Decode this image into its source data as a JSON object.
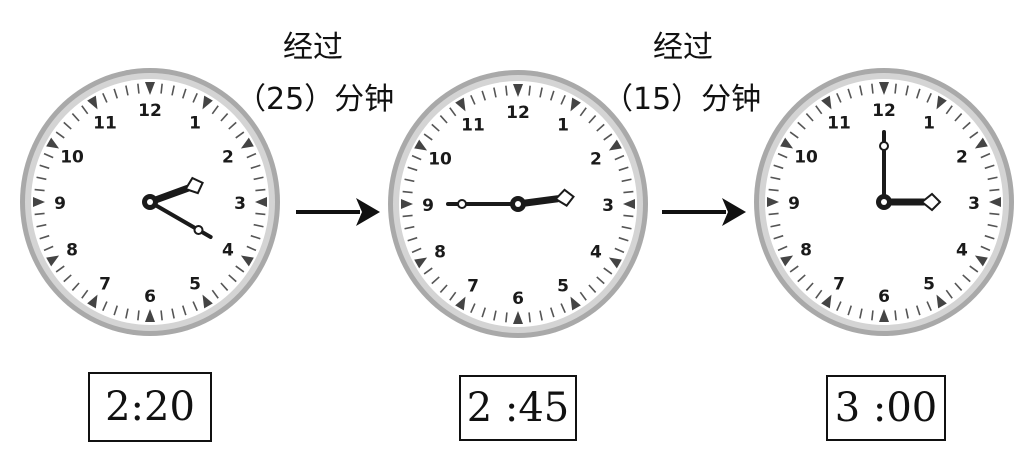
{
  "clocks": [
    {
      "id": "clock-1",
      "hour": 2,
      "minute": 20,
      "time_label": "2:20"
    },
    {
      "id": "clock-2",
      "hour": 2,
      "minute": 45,
      "time_label": "2 :45"
    },
    {
      "id": "clock-3",
      "hour": 3,
      "minute": 0,
      "time_label": "3 :00"
    }
  ],
  "dial_numbers": [
    "12",
    "1",
    "2",
    "3",
    "4",
    "5",
    "6",
    "7",
    "8",
    "9",
    "10",
    "11"
  ],
  "transitions": [
    {
      "verb": "经过",
      "duration": "（25）分钟"
    },
    {
      "verb": "经过",
      "duration": "（15）分钟"
    }
  ],
  "colors": {
    "bezel": "#a9a9a9",
    "bezel_inner": "#d4d4d4",
    "ink": "#1a1a1a"
  }
}
